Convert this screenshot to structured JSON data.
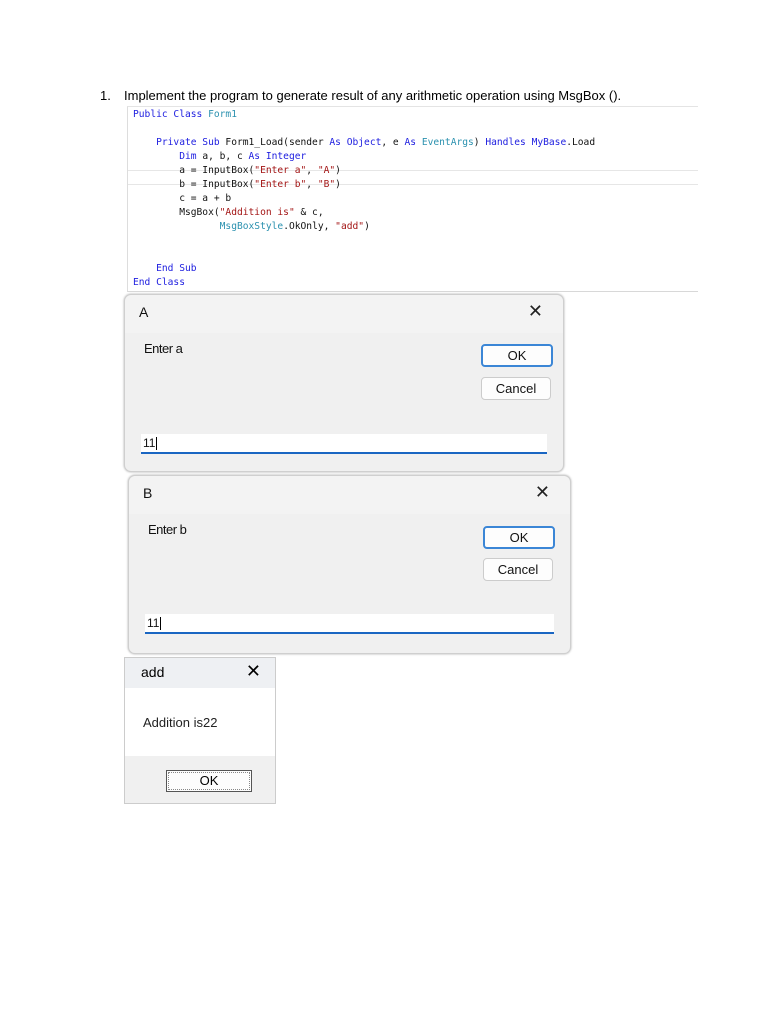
{
  "question": {
    "number": "1.",
    "text": "Implement the program to generate result of any arithmetic operation using MsgBox ()."
  },
  "code_lines": [
    [
      [
        "Public Class ",
        "k"
      ],
      [
        "Form1",
        "t"
      ]
    ],
    [],
    [
      [
        "    Private Sub ",
        "k"
      ],
      [
        "Form1_Load(sender ",
        "n"
      ],
      [
        "As ",
        "k"
      ],
      [
        "Object",
        "k"
      ],
      [
        ", e ",
        "n"
      ],
      [
        "As ",
        "k"
      ],
      [
        "EventArgs",
        "t"
      ],
      [
        ") ",
        "n"
      ],
      [
        "Handles ",
        "k"
      ],
      [
        "MyBase",
        "k"
      ],
      [
        ".Load",
        "n"
      ]
    ],
    [
      [
        "        Dim ",
        "k"
      ],
      [
        "a, b, c ",
        "n"
      ],
      [
        "As Integer",
        "k"
      ]
    ],
    [
      [
        "        a = InputBox(",
        "n"
      ],
      [
        "\"Enter a\"",
        "s"
      ],
      [
        ", ",
        "n"
      ],
      [
        "\"A\"",
        "s"
      ],
      [
        ")",
        "n"
      ]
    ],
    [
      [
        "        b = InputBox(",
        "n"
      ],
      [
        "\"Enter b\"",
        "s"
      ],
      [
        ", ",
        "n"
      ],
      [
        "\"B\"",
        "s"
      ],
      [
        ")",
        "n"
      ]
    ],
    [
      [
        "        c = a + b",
        "n"
      ]
    ],
    [
      [
        "        MsgBox(",
        "n"
      ],
      [
        "\"Addition is\"",
        "s"
      ],
      [
        " & c,",
        "n"
      ]
    ],
    [
      [
        "               MsgBoxStyle",
        "t"
      ],
      [
        ".OkOnly, ",
        "n"
      ],
      [
        "\"add\"",
        "s"
      ],
      [
        ")",
        "n"
      ]
    ],
    [],
    [],
    [
      [
        "    End Sub",
        "k"
      ]
    ],
    [
      [
        "End Class",
        "k"
      ]
    ]
  ],
  "dialog_a": {
    "title": "A",
    "prompt": "Enter a",
    "ok": "OK",
    "cancel": "Cancel",
    "value": "11",
    "close": "✕"
  },
  "dialog_b": {
    "title": "B",
    "prompt": "Enter b",
    "ok": "OK",
    "cancel": "Cancel",
    "value": "11",
    "close": "✕"
  },
  "msgbox": {
    "title": "add",
    "message": "Addition is22",
    "ok": "OK",
    "close": "✕"
  }
}
